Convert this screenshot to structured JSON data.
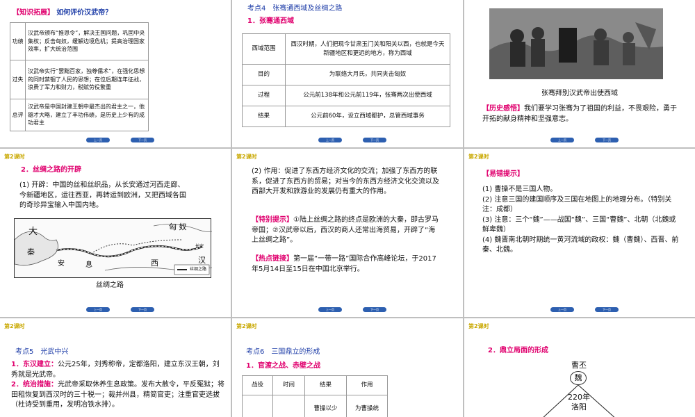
{
  "slide1": {
    "heading_tag": "【知识拓展】",
    "heading_q": "如何评价汉武帝？",
    "rows": [
      {
        "label": "功绩",
        "text": "汉武帝颁布“推恩令”，解决王国问题，巩固中央集权；反击匈奴，缓解边境危机；提高治理国家效率，扩大统治范围"
      },
      {
        "label": "过失",
        "text": "汉武帝实行“罢黜百家，独尊儒术”，在强化思想的同时禁锢了人民的思想；在位后期连年征战，浪费了军力和财力，税赋劳役繁重"
      },
      {
        "label": "总评",
        "text": "汉武帝是中国封建王朝中最杰出的君主之一，他雄才大略，建立了丰功伟绩，是历史上少有的成功君主"
      }
    ]
  },
  "slide2": {
    "title": "考点4　张骞通西域及丝绸之路",
    "subtitle": "1．张骞通西域",
    "rows": [
      {
        "label": "西域范围",
        "text": "西汉时期，人们把现今甘肃玉门关和阳关以西，也就是今天新疆地区和更远的地方，称为西域"
      },
      {
        "label": "目的",
        "text": "为联络大月氏，共同夹击匈奴"
      },
      {
        "label": "过程",
        "text": "公元前138年和公元前119年，张骞两次出使西域"
      },
      {
        "label": "结果",
        "text": "公元前60年，设立西域都护，总管西域事务"
      }
    ]
  },
  "slide3": {
    "caption": "张骞拜别汉武帝出使西域",
    "feel_tag": "【历史感悟】",
    "feel_text": "我们要学习张骞为了祖国的利益，不畏艰险，勇于开拓的献身精神和坚强意志。"
  },
  "slide4": {
    "tag": "第2课时",
    "heading": "2．丝绸之路的开辟",
    "body": "(1) 开辟：中国的丝和丝织品，从长安通过河西走廊、今新疆地区，运往西亚，再转运到欧洲，又把西域各国的奇珍异宝输入中国内地。",
    "map_labels": {
      "dayue": "大",
      "qin": "秦",
      "anxi": "安",
      "xi": "息",
      "xiongnu": "匈 奴",
      "han": "汉",
      "west": "西",
      "changan": "长安",
      "legend": "丝绸之路"
    },
    "caption": "丝绸之路"
  },
  "slide5": {
    "tag": "第2课时",
    "para1": "(2) 作用：促进了东西方经济文化的交流；加强了东西方的联系，促进了东西方的贸易；对当今的东西方经济文化交流以及西部大开发和旅游业的发展仍有重大的作用。",
    "special_tag": "【特别提示】",
    "special_text": "①陆上丝绸之路的终点是欧洲的大秦，即古罗马帝国；②汉武帝以后，西汉的商人还常出海贸易，开辟了“海上丝绸之路”。",
    "hot_tag": "【热点链接】",
    "hot_text": "第一届“一带一路”国际合作高峰论坛，于2017年5月14日至15日在中国北京举行。"
  },
  "slide6": {
    "tag": "第2课时",
    "heading": "【易错提示】",
    "items": [
      "(1) 曹操不是三国人物。",
      "(2) 注意三国的建国顺序及三国在地图上的地理分布。（特别关注：成都）",
      "(3) 注意：三个“魏”——战国“魏”、三国“曹魏”、北朝（北魏或鲜卑魏）",
      "(4) 魏晋南北朝时期统一黄河流域的政权：魏（曹魏）、西晋、前秦、北魏。"
    ]
  },
  "slide7": {
    "tag": "第2课时",
    "title": "考点5　光武中兴",
    "p1_head": "1．东汉建立：",
    "p1_text": "公元25年，刘秀称帝，定都洛阳，建立东汉王朝，刘秀就是光武帝。",
    "p2_head": "2．统治措施：",
    "p2_text": "光武帝采取休养生息政策。发布大赦令，平反冤狱；将田租恢复到西汉时的三十税一；裁并州县，精简官吏；注重官吏选拔（杜诗受到重用，发明冶铁水排）。"
  },
  "slide8": {
    "tag": "第2课时",
    "title": "考点6　三国鼎立的形成",
    "subtitle": "1．官渡之战、赤壁之战",
    "headers": [
      "战役",
      "时间",
      "结果",
      "作用"
    ],
    "row1": [
      "",
      "",
      "曹操以少",
      "为曹操统"
    ]
  },
  "slide9": {
    "tag": "第2课时",
    "heading": "2．鼎立局面的形成",
    "person": "曹丕",
    "state": "魏",
    "year": "220年",
    "capital": "洛阳"
  },
  "nav": {
    "prev": "上一页",
    "next": "下一页"
  }
}
